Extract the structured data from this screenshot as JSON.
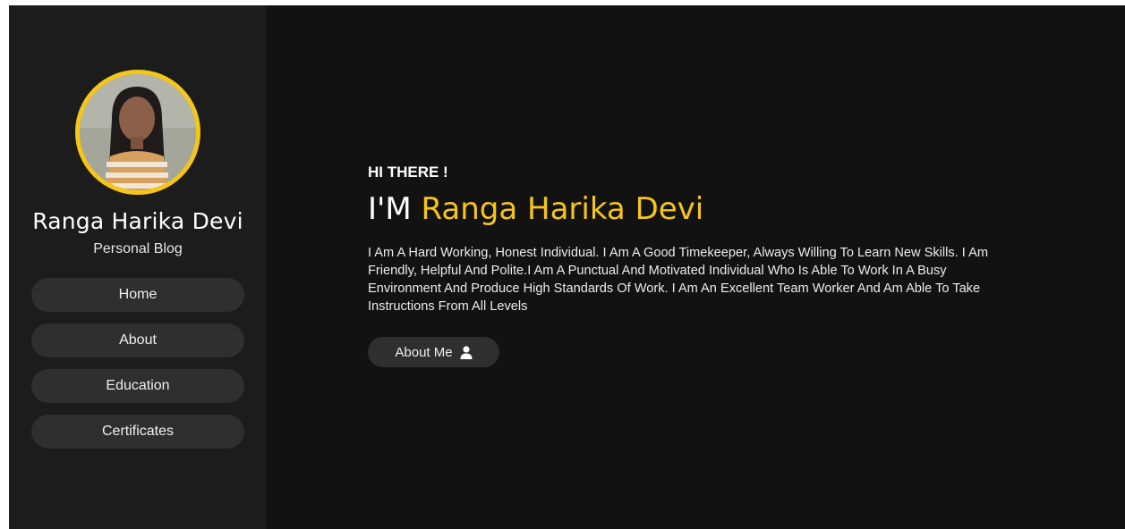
{
  "sidebar": {
    "name": "Ranga Harika Devi",
    "subtitle": "Personal Blog",
    "nav": [
      {
        "label": "Home"
      },
      {
        "label": "About"
      },
      {
        "label": "Education"
      },
      {
        "label": "Certificates"
      }
    ]
  },
  "hero": {
    "greeting": "HI THERE !",
    "headline_prefix": "I'M",
    "headline_name": "Ranga Harika Devi",
    "bio": "I Am A Hard Working, Honest Individual. I Am A Good Timekeeper, Always Willing To Learn New Skills. I Am Friendly, Helpful And Polite.I Am A Punctual And Motivated Individual Who Is Able To Work In A Busy Environment And Produce High Standards Of Work. I Am An Excellent Team Worker And Am Able To Take Instructions From All Levels",
    "button_label": "About Me",
    "button_icon": "user-icon"
  },
  "colors": {
    "accent": "#f5c518",
    "background": "#121212",
    "sidebar": "#1c1c1c",
    "button": "#2f2f2f"
  }
}
